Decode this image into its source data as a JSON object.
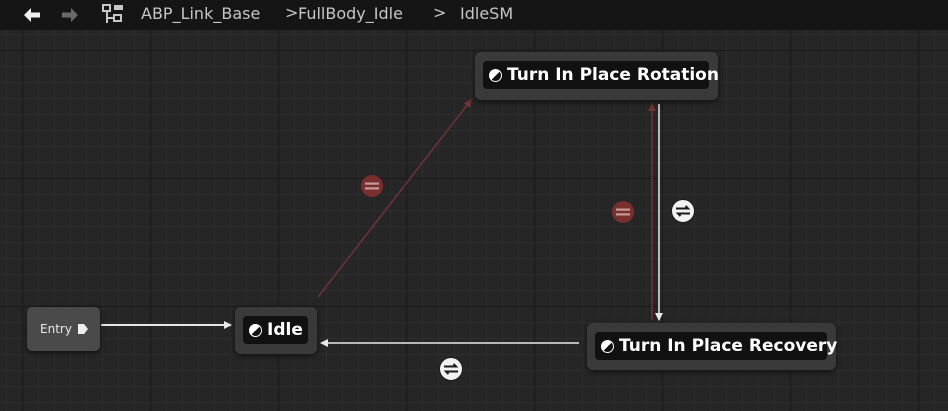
{
  "toolbar": {
    "back_icon": "arrow-left-icon",
    "forward_icon": "arrow-right-icon",
    "hierarchy_icon": "hierarchy-icon",
    "breadcrumbs": [
      "ABP_Link_Base",
      "FullBody_Idle",
      "IdleSM"
    ],
    "separator": ">"
  },
  "graph": {
    "entry_label": "Entry",
    "states": {
      "turn_in_place_rotation": "Turn In Place Rotation",
      "idle": "Idle",
      "turn_in_place_recovery": "Turn In Place Recovery"
    }
  },
  "colors": {
    "active_wire": "#e8e8e8",
    "inactive_wire": "#6e3434",
    "active_transition": "#f2f2f2",
    "inactive_transition": "#7a2f2f",
    "node_body": "#3a3a3a",
    "node_title": "#111111"
  }
}
